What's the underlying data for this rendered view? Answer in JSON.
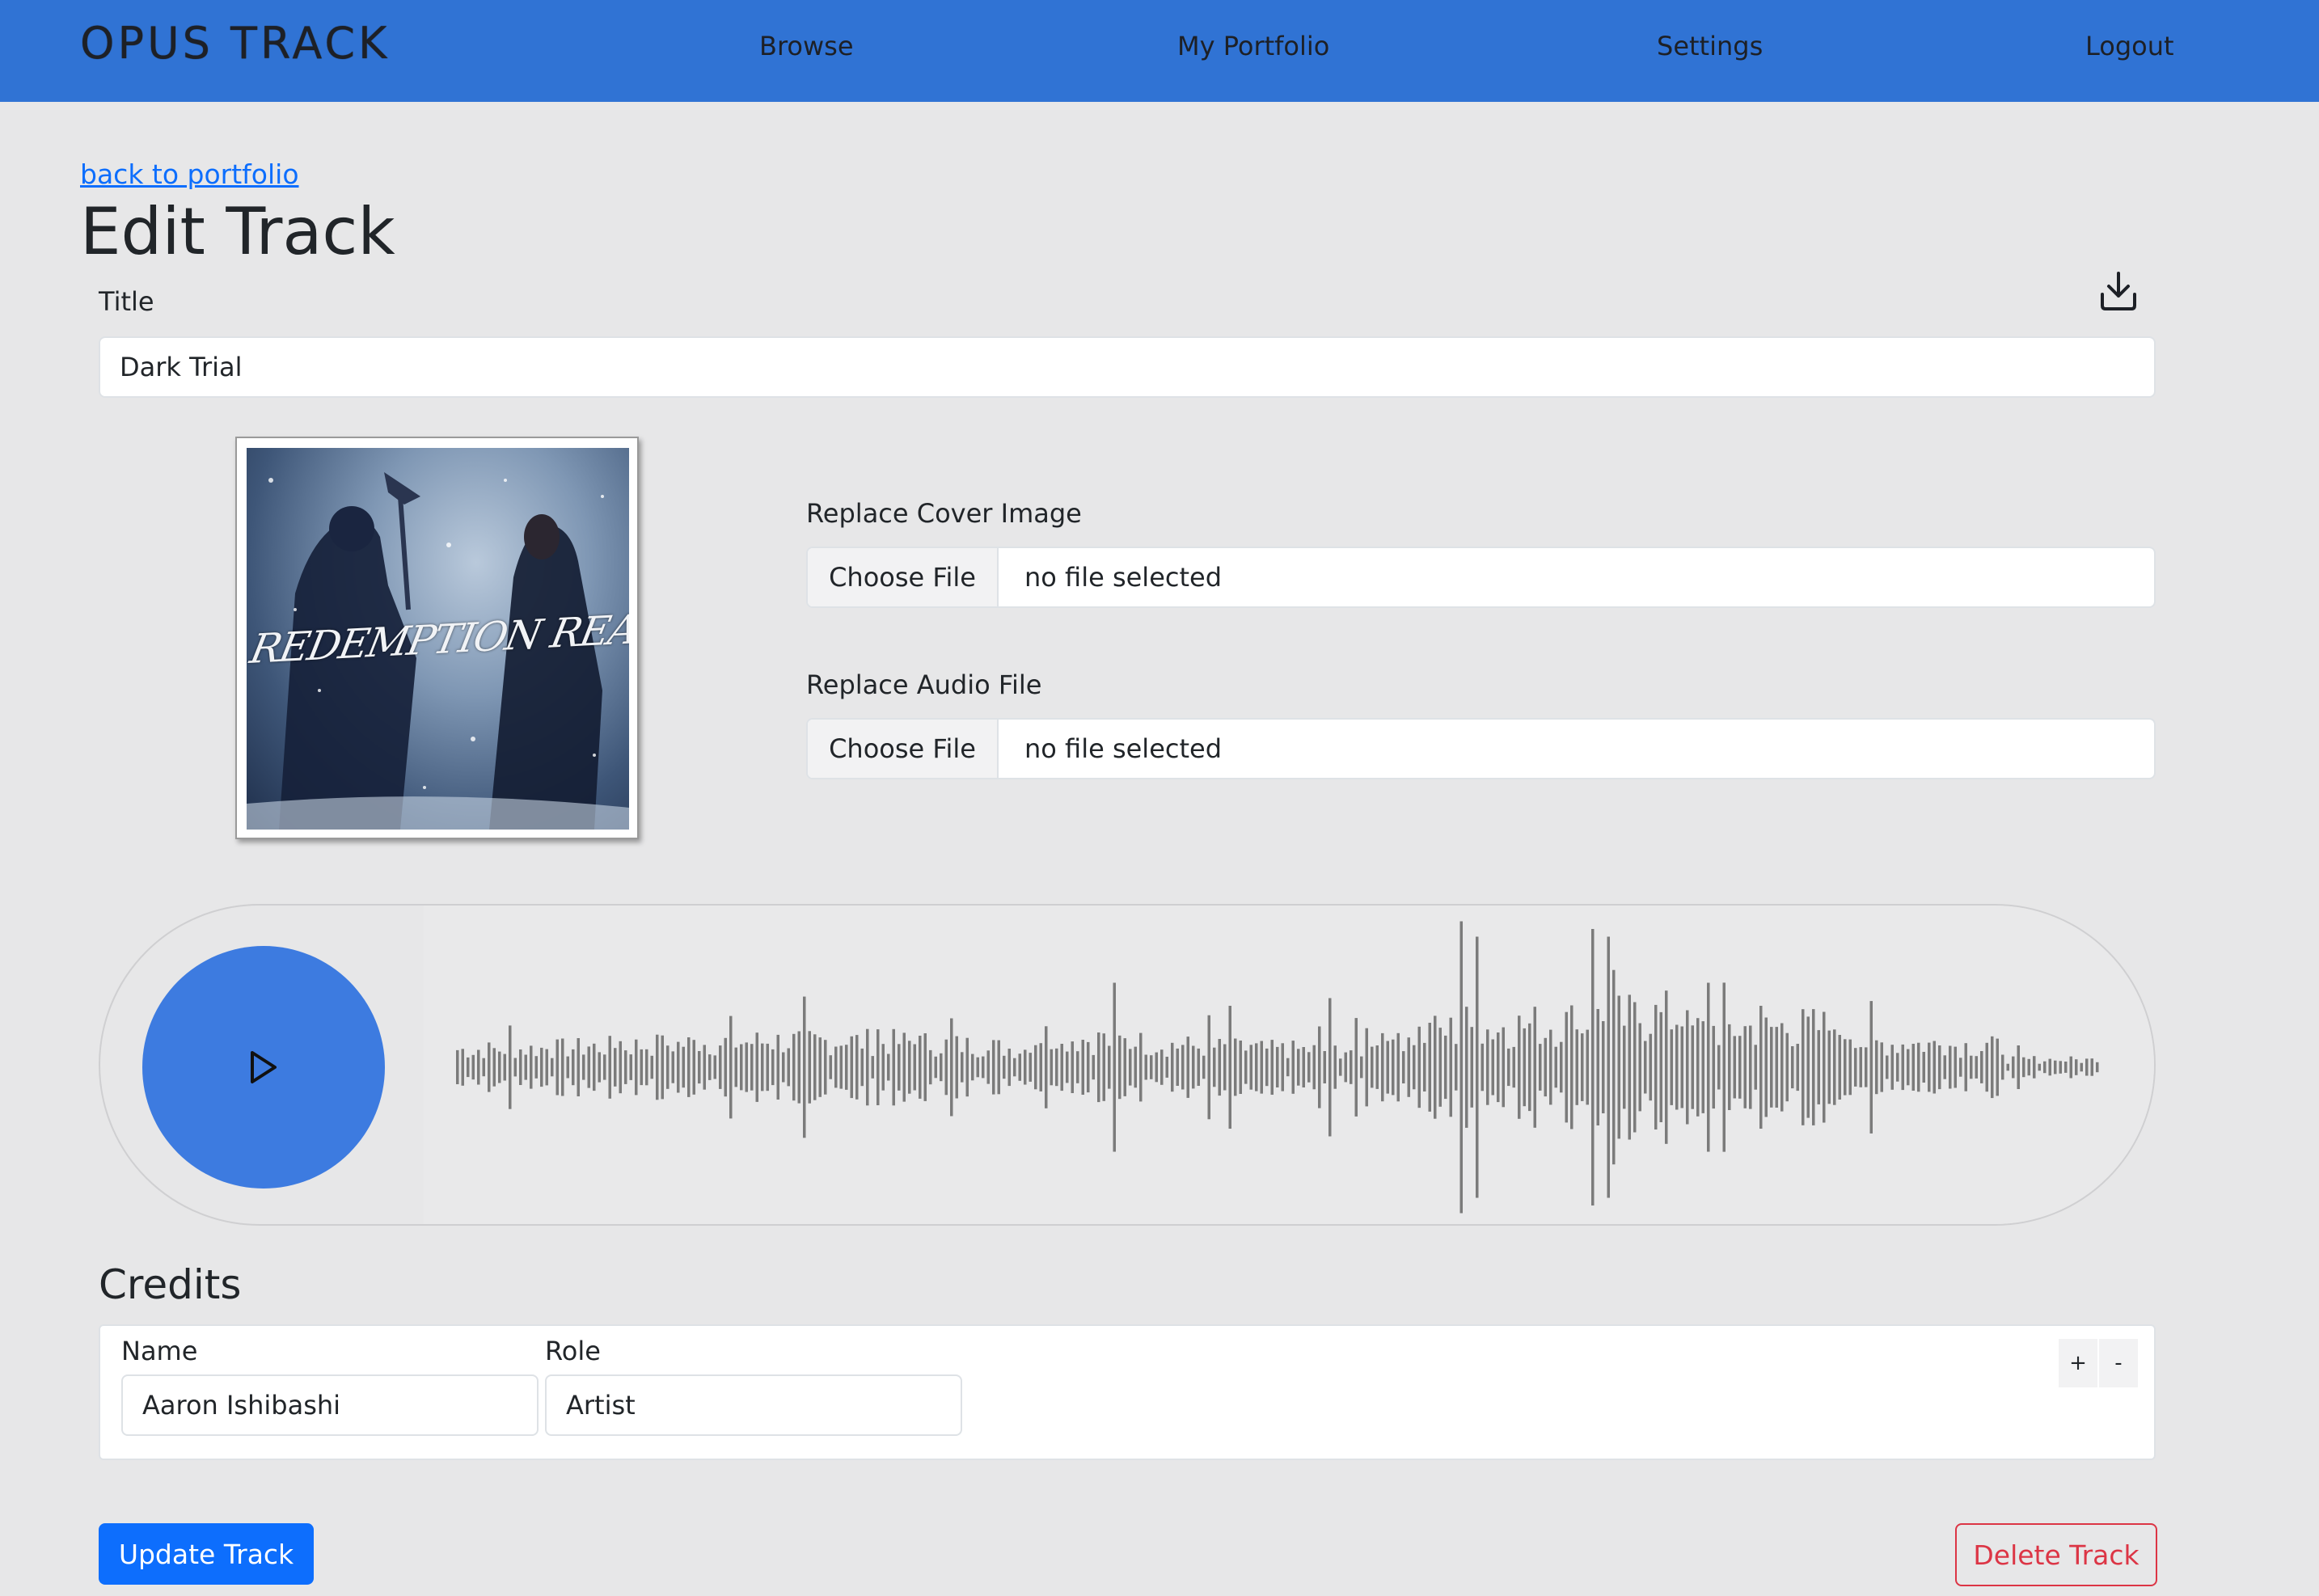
{
  "nav": {
    "brand": "OPUS TRACK",
    "links": [
      "Browse",
      "My Portfolio",
      "Settings",
      "Logout"
    ]
  },
  "page": {
    "back_link": "back to portfolio",
    "title": "Edit Track"
  },
  "form": {
    "title_label": "Title",
    "title_value": "Dark Trial",
    "download_icon": "download-icon",
    "cover_text": "REDEMPTION REAPERS",
    "replace_cover_label": "Replace Cover Image",
    "replace_audio_label": "Replace Audio File",
    "choose_file_label": "Choose File",
    "no_file_label": "no file selected"
  },
  "player": {
    "play_icon": "play-icon"
  },
  "credits": {
    "heading": "Credits",
    "name_label": "Name",
    "role_label": "Role",
    "name_value": "Aaron Ishibashi",
    "role_value": "Artist",
    "add_label": "+",
    "remove_label": "-"
  },
  "actions": {
    "update_label": "Update Track",
    "delete_label": "Delete Track"
  },
  "colors": {
    "navbar": "#3073d4",
    "play_button": "#3d7be0",
    "primary": "#0d6efd",
    "danger": "#dc3545",
    "waveform": "#7b7b7b"
  }
}
